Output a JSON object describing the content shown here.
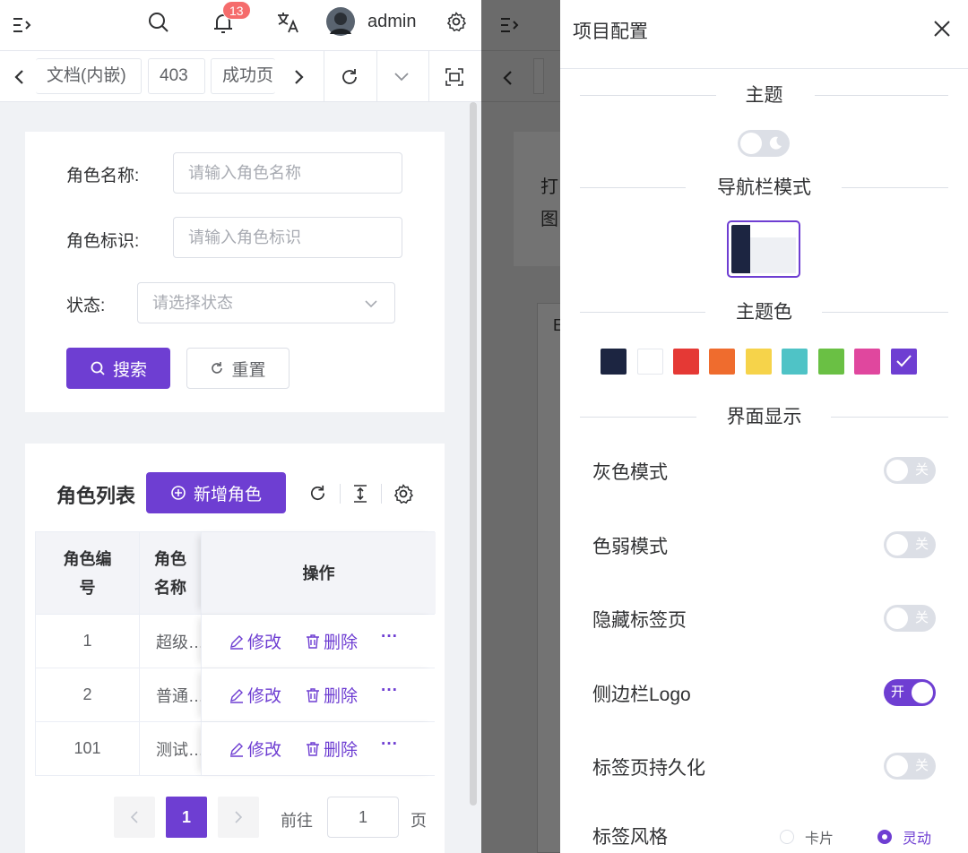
{
  "header": {
    "user_name": "admin",
    "notification_count": "13"
  },
  "tabs": {
    "items": [
      "文档(内嵌)",
      "403",
      "成功页"
    ]
  },
  "search_form": {
    "fields": [
      {
        "label": "角色名称:",
        "placeholder": "请输入角色名称"
      },
      {
        "label": "角色标识:",
        "placeholder": "请输入角色标识"
      },
      {
        "label": "状态:",
        "placeholder": "请选择状态"
      }
    ],
    "search_label": "搜索",
    "reset_label": "重置"
  },
  "list": {
    "title": "角色列表",
    "add_label": "新增角色",
    "columns": [
      "角色编号",
      "角色名称",
      "操作"
    ],
    "rows": [
      {
        "id": "1",
        "name": "超级…"
      },
      {
        "id": "2",
        "name": "普通…"
      },
      {
        "id": "101",
        "name": "测试…"
      }
    ],
    "edit_label": "修改",
    "delete_label": "删除",
    "more_label": "···"
  },
  "pagination": {
    "current_page": "1",
    "goto_label": "前往",
    "goto_value": "1",
    "page_unit": "页"
  },
  "background_page": {
    "fragment_line1": "打",
    "fragment_line2": "图",
    "fragment_3": "E"
  },
  "settings": {
    "title": "项目配置",
    "sections": {
      "theme": "主题",
      "nav_mode": "导航栏模式",
      "theme_color": "主题色",
      "display": "界面显示"
    },
    "theme_colors": [
      "#1c2541",
      "#ffffff",
      "#e53935",
      "#ef6c2e",
      "#f6d34a",
      "#4fc3c6",
      "#6ac044",
      "#e0479e",
      "#6e3ed2"
    ],
    "selected_color": "#6e3ed2",
    "toggles": [
      {
        "label": "灰色模式",
        "state": "关",
        "on": false
      },
      {
        "label": "色弱模式",
        "state": "关",
        "on": false
      },
      {
        "label": "隐藏标签页",
        "state": "关",
        "on": false
      },
      {
        "label": "侧边栏Logo",
        "state": "开",
        "on": true
      },
      {
        "label": "标签页持久化",
        "state": "关",
        "on": false
      }
    ],
    "tab_style": {
      "label": "标签风格",
      "options": [
        "卡片",
        "灵动"
      ],
      "selected": "灵动"
    }
  },
  "colors": {
    "primary": "#6e3ed2",
    "danger_badge": "#f56c6c"
  }
}
